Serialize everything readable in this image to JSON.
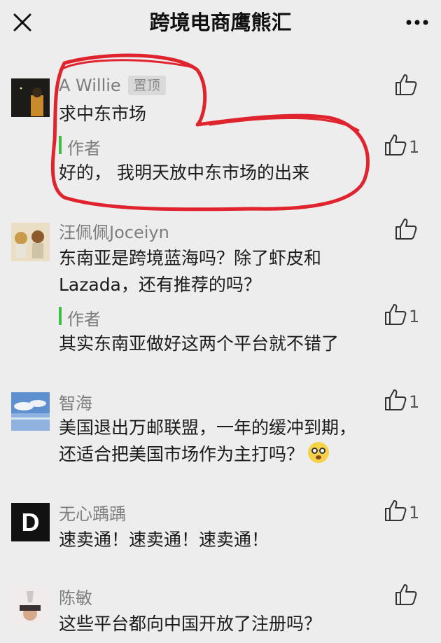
{
  "nav": {
    "title": "跨境电商鹰熊汇"
  },
  "comments": [
    {
      "name": "A Willie",
      "badge": "置顶",
      "text": [
        "求中东市场"
      ],
      "likes": "",
      "reply": {
        "label": "作者",
        "text": "好的， 我明天放中东市场的出来",
        "likes": "1"
      }
    },
    {
      "name": "汪佩佩Joceiyn",
      "text": [
        "东南亚是跨境蓝海吗？除了虾皮和",
        "Lazada，还有推荐的吗？"
      ],
      "likes": "",
      "reply": {
        "label": "作者",
        "text": "其实东南亚做好这两个平台就不错了",
        "likes": "1"
      }
    },
    {
      "name": "智海",
      "text": [
        "美国退出万邮联盟，一年的缓冲到期，",
        "还适合把美国市场作为主打吗？"
      ],
      "likes": "1"
    },
    {
      "name": "无心踽踽",
      "avatar_letter": "D",
      "text": [
        "速卖通！速卖通！速卖通！"
      ],
      "likes": "1"
    },
    {
      "name": "陈敏",
      "text": [
        "这些平台都向中国开放了注册吗？"
      ],
      "likes": ""
    }
  ],
  "colors": {
    "accent_bar": "#3fbf3f",
    "annotation": "#e0242e",
    "background": "#ededed"
  }
}
